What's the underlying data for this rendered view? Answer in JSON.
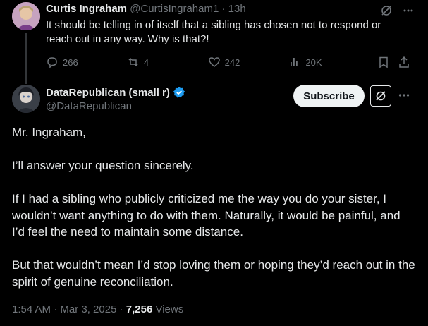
{
  "parent": {
    "name": "Curtis Ingraham",
    "handle": "@CurtisIngraham1",
    "separator": "·",
    "time": "13h",
    "text": "It should be telling in of itself that a sibling has chosen not to respond or reach out in any way. Why is that?!",
    "stats": {
      "replies": "266",
      "reposts": "4",
      "likes": "242",
      "views": "20K"
    }
  },
  "tweet": {
    "name": "DataRepublican (small r)",
    "handle": "@DataRepublican",
    "subscribe_label": "Subscribe",
    "paragraphs": [
      "Mr. Ingraham,",
      "I’ll answer your question sincerely.",
      "If I had a sibling who publicly criticized me the way you do your sister, I wouldn’t want anything to do with them. Naturally, it would be painful, and I’d feel the need to maintain some distance.",
      "But that wouldn’t mean I’d stop loving them or hoping they’d reach out in the spirit of genuine reconciliation."
    ],
    "timestamp": "1:54 AM · Mar 3, 2025 · ",
    "views_count": "7,256",
    "views_label": " Views"
  },
  "colors": {
    "background": "#000000",
    "text": "#e7e9ea",
    "muted": "#71767b",
    "verified": "#1d9bf0",
    "thread_line": "#333639"
  },
  "icons": [
    "grok-icon",
    "more-icon",
    "reply-icon",
    "repost-icon",
    "like-icon",
    "views-icon",
    "bookmark-icon",
    "share-icon",
    "verified-badge-icon"
  ]
}
